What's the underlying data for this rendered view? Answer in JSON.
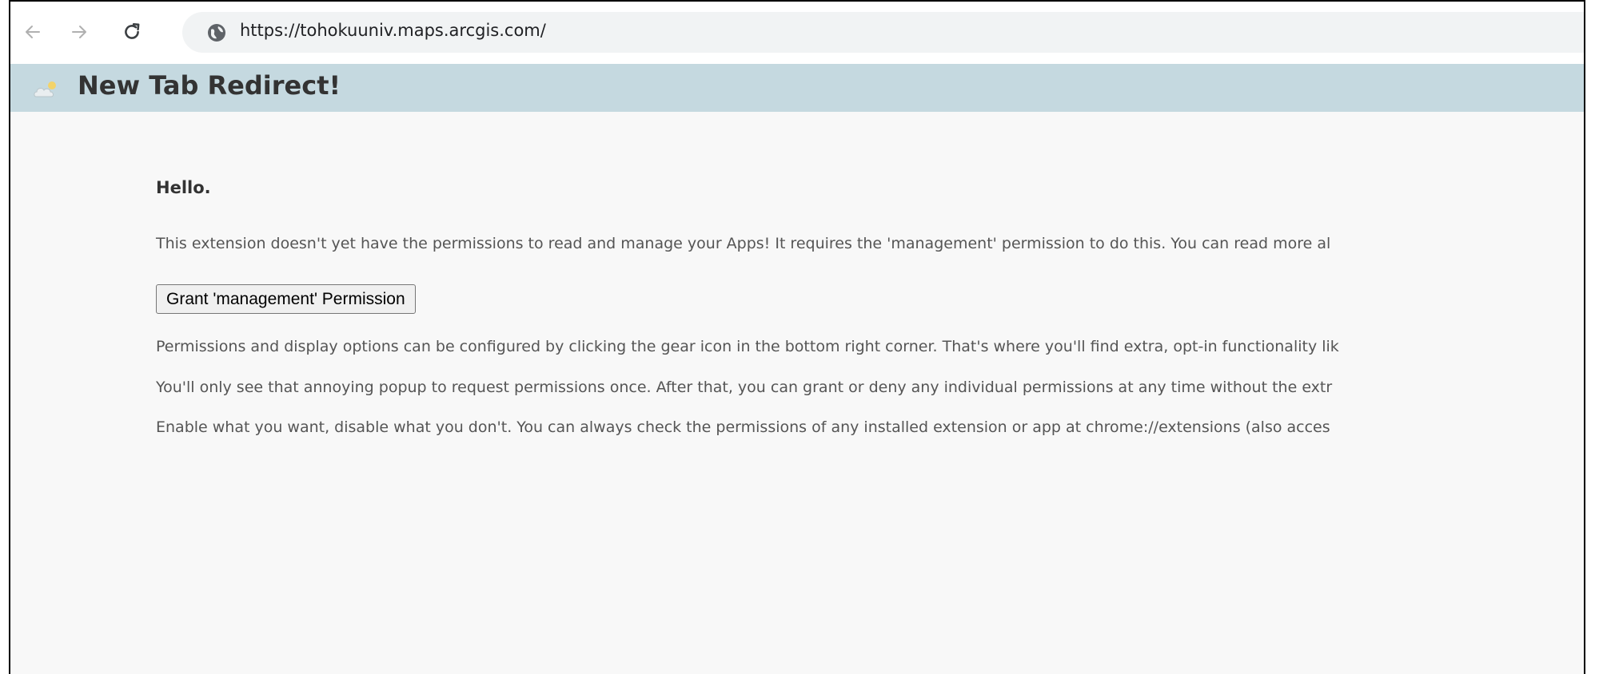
{
  "browser": {
    "url": "https://tohokuuniv.maps.arcgis.com/",
    "icons": {
      "back": "arrow-left-icon",
      "forward": "arrow-right-icon",
      "reload": "reload-icon",
      "site_info": "globe-icon"
    }
  },
  "extension": {
    "title": "New Tab Redirect!",
    "icon": "cloud-sun-icon"
  },
  "content": {
    "greeting": "Hello.",
    "intro": "This extension doesn't yet have the permissions to read and manage your Apps! It requires the 'management' permission to do this. You can read more al",
    "grant_button": "Grant 'management' Permission",
    "para_configure": "Permissions and display options can be configured by clicking the gear icon in the bottom right corner. That's where you'll find extra, opt-in functionality lik",
    "para_popup": "You'll only see that annoying popup to request permissions once. After that, you can grant or deny any individual permissions at any time without the extr",
    "para_enable": "Enable what you want, disable what you don't. You can always check the permissions of any installed extension or app at chrome://extensions (also acces"
  },
  "colors": {
    "header_band": "#c5d9e0",
    "page_bg": "#f8f8f8",
    "omnibox_bg": "#f1f3f4"
  }
}
